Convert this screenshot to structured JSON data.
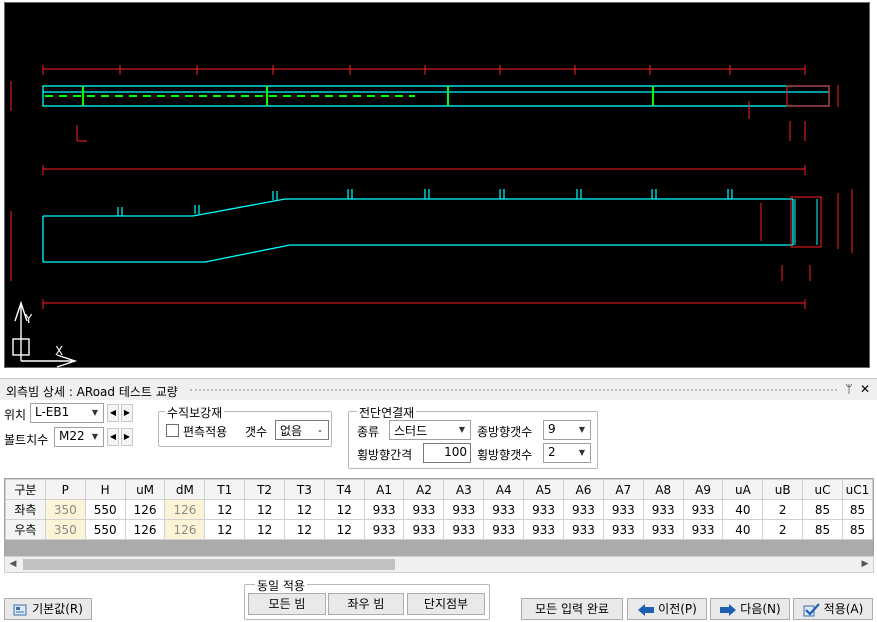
{
  "panel": {
    "title": "외측빔 상세 : ARoad 테스트 교량",
    "pin": "ᛘ",
    "close": "✕"
  },
  "controls": {
    "position_label": "위치",
    "position_value": "L-EB1",
    "bolt_label": "볼트치수",
    "bolt_value": "M22",
    "vertical_group": "수직보강재",
    "eccentric_label": "편측적용",
    "count_label": "갯수",
    "count_value": "없음",
    "shear_group": "전단연결재",
    "type_label": "종류",
    "type_value": "스터드",
    "long_count_label": "종방향갯수",
    "long_count_value": "9",
    "trans_spacing_label": "횡방향간격",
    "trans_spacing_value": "100",
    "trans_count_label": "횡방향갯수",
    "trans_count_value": "2"
  },
  "grid": {
    "columns": [
      "구분",
      "P",
      "H",
      "uM",
      "dM",
      "T1",
      "T2",
      "T3",
      "T4",
      "A1",
      "A2",
      "A3",
      "A4",
      "A5",
      "A6",
      "A7",
      "A8",
      "A9",
      "uA",
      "uB",
      "uC",
      "uC1"
    ],
    "rows": [
      [
        "좌측",
        "350",
        "550",
        "126",
        "126",
        "12",
        "12",
        "12",
        "12",
        "933",
        "933",
        "933",
        "933",
        "933",
        "933",
        "933",
        "933",
        "933",
        "40",
        "2",
        "85",
        "85"
      ],
      [
        "우측",
        "350",
        "550",
        "126",
        "126",
        "12",
        "12",
        "12",
        "12",
        "933",
        "933",
        "933",
        "933",
        "933",
        "933",
        "933",
        "933",
        "933",
        "40",
        "2",
        "85",
        "85"
      ]
    ]
  },
  "buttons": {
    "default": "기본값(R)",
    "same_apply_group": "동일 적용",
    "all_beams": "모든 빔",
    "left_right": "좌우 빔",
    "span_end": "단지점부",
    "all_done": "모든 입력 완료",
    "prev": "이전(P)",
    "next": "다음(N)",
    "apply": "적용(A)"
  },
  "colors": {
    "cad_bg": "#000000",
    "cad_beam": "#00ffff",
    "cad_stiffener": "#00ff00",
    "cad_dimension": "#ff0000",
    "highlight_cell": "#fdf3d6",
    "arrow_blue": "#1e5fb4"
  },
  "icons": {
    "default": "settings-restore-icon",
    "prev": "arrow-left-icon",
    "next": "arrow-right-icon",
    "apply": "check-icon",
    "ucs": "ucs-axis-icon"
  }
}
